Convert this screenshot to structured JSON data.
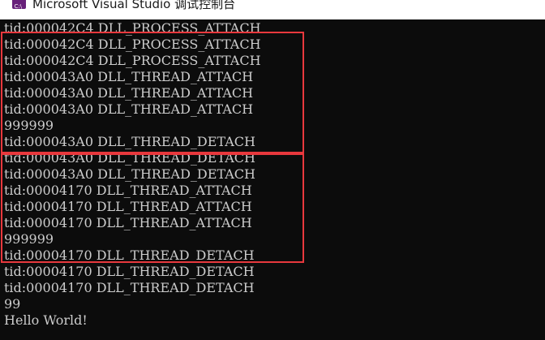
{
  "window": {
    "title": "Microsoft Visual Studio 调试控制台",
    "icon": "visual-studio-icon",
    "accent_color": "#68217a"
  },
  "console": {
    "background": "#0c0c0c",
    "text_color": "#cccccc",
    "lines": [
      "tid:000042C4 DLL_PROCESS_ATTACH",
      "tid:000042C4 DLL_PROCESS_ATTACH",
      "tid:000042C4 DLL_PROCESS_ATTACH",
      "tid:000043A0 DLL_THREAD_ATTACH",
      "tid:000043A0 DLL_THREAD_ATTACH",
      "tid:000043A0 DLL_THREAD_ATTACH",
      "999999",
      "tid:000043A0 DLL_THREAD_DETACH",
      "tid:000043A0 DLL_THREAD_DETACH",
      "tid:000043A0 DLL_THREAD_DETACH",
      "tid:00004170 DLL_THREAD_ATTACH",
      "tid:00004170 DLL_THREAD_ATTACH",
      "tid:00004170 DLL_THREAD_ATTACH",
      "999999",
      "tid:00004170 DLL_THREAD_DETACH",
      "tid:00004170 DLL_THREAD_DETACH",
      "tid:00004170 DLL_THREAD_DETACH",
      "99",
      "Hello World!"
    ]
  },
  "annotations": {
    "highlight_color": "#e8383d"
  }
}
